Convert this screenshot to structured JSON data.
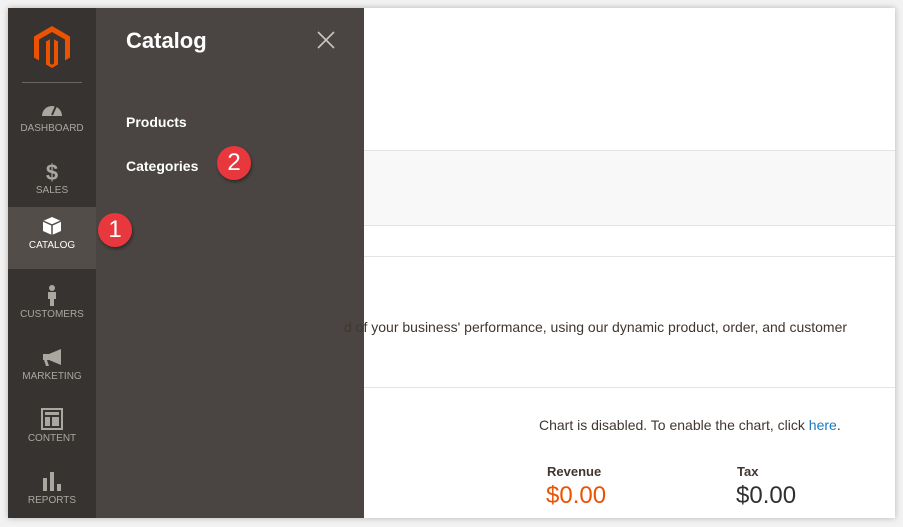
{
  "sidebar": {
    "items": [
      {
        "label": "DASHBOARD",
        "icon": "dashboard-icon"
      },
      {
        "label": "SALES",
        "icon": "dollar-icon"
      },
      {
        "label": "CATALOG",
        "icon": "box-icon",
        "active": true
      },
      {
        "label": "CUSTOMERS",
        "icon": "person-icon"
      },
      {
        "label": "MARKETING",
        "icon": "megaphone-icon"
      },
      {
        "label": "CONTENT",
        "icon": "layout-icon"
      },
      {
        "label": "REPORTS",
        "icon": "bar-chart-icon"
      }
    ]
  },
  "flyout": {
    "title": "Catalog",
    "items": [
      {
        "label": "Products"
      },
      {
        "label": "Categories"
      }
    ]
  },
  "annotations": {
    "one": "1",
    "two": "2"
  },
  "main": {
    "intro": "d of your business' performance, using our dynamic product, order, and customer",
    "chart_msg": "Chart is disabled. To enable the chart, click ",
    "chart_link": "here",
    "chart_end": ".",
    "revenue_label": "Revenue",
    "revenue_value": "$0.00",
    "tax_label": "Tax",
    "tax_value": "$0.00"
  },
  "colors": {
    "accent": "#eb5202",
    "badge": "#e8383d",
    "link": "#1979c3"
  }
}
